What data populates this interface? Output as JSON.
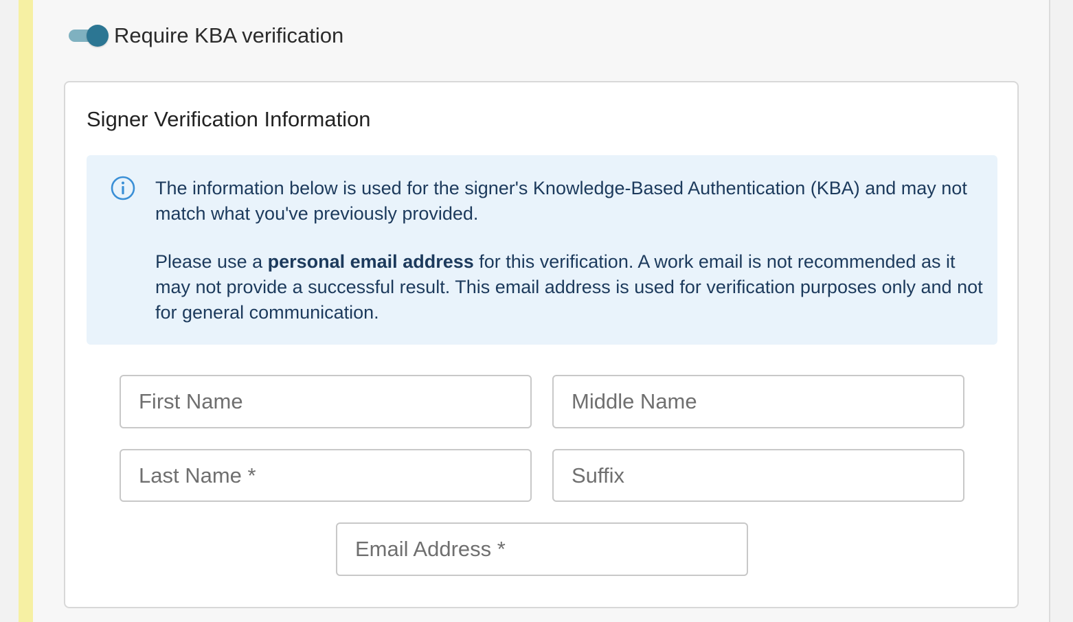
{
  "kba_toggle": {
    "label": "Require KBA verification",
    "enabled": true
  },
  "card": {
    "title": "Signer Verification Information",
    "info": {
      "icon": "info-circle-icon",
      "paragraph1": "The information below is used for the signer's Knowledge-Based Authentication (KBA) and may not match what you've previously provided.",
      "paragraph2_prefix": "Please use a ",
      "paragraph2_bold": "personal email address",
      "paragraph2_suffix": " for this verification. A work email is not recommended as it may not provide a successful result. This email address is used for verification purposes only and not for general communication."
    },
    "fields": {
      "first_name": {
        "placeholder": "First Name",
        "value": ""
      },
      "middle_name": {
        "placeholder": "Middle Name",
        "value": ""
      },
      "last_name": {
        "placeholder": "Last Name *",
        "value": ""
      },
      "suffix": {
        "placeholder": "Suffix",
        "value": ""
      },
      "email": {
        "placeholder": "Email Address *",
        "value": ""
      }
    }
  },
  "colors": {
    "accent_bar": "#f6f0a3",
    "toggle_knob": "#2c7693",
    "toggle_track": "#7fb1c0",
    "info_background": "#e9f3fb",
    "info_text": "#1c3a5c",
    "info_icon": "#3a8fd6"
  }
}
